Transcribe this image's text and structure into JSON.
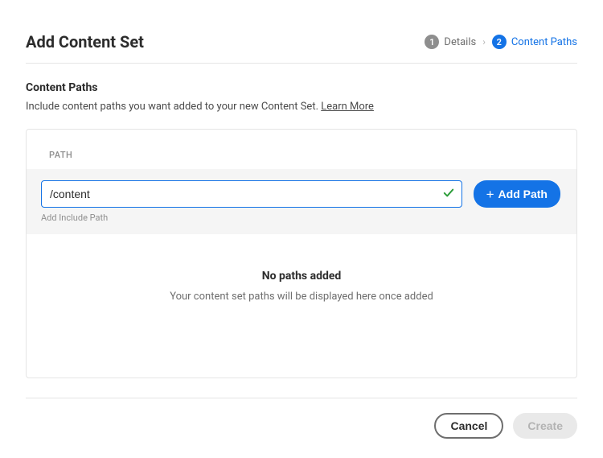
{
  "header": {
    "title": "Add Content Set"
  },
  "wizard": {
    "step1": {
      "num": "1",
      "label": "Details"
    },
    "step2": {
      "num": "2",
      "label": "Content Paths"
    }
  },
  "section": {
    "title": "Content Paths",
    "description": "Include content paths you want added to your new Content Set. ",
    "learn_more": "Learn More"
  },
  "table": {
    "header_path": "PATH",
    "input_value": "/content",
    "helper": "Add Include Path",
    "add_button": "Add Path",
    "empty_title": "No paths added",
    "empty_desc": "Your content set paths will be displayed here once added"
  },
  "footer": {
    "cancel": "Cancel",
    "create": "Create"
  }
}
